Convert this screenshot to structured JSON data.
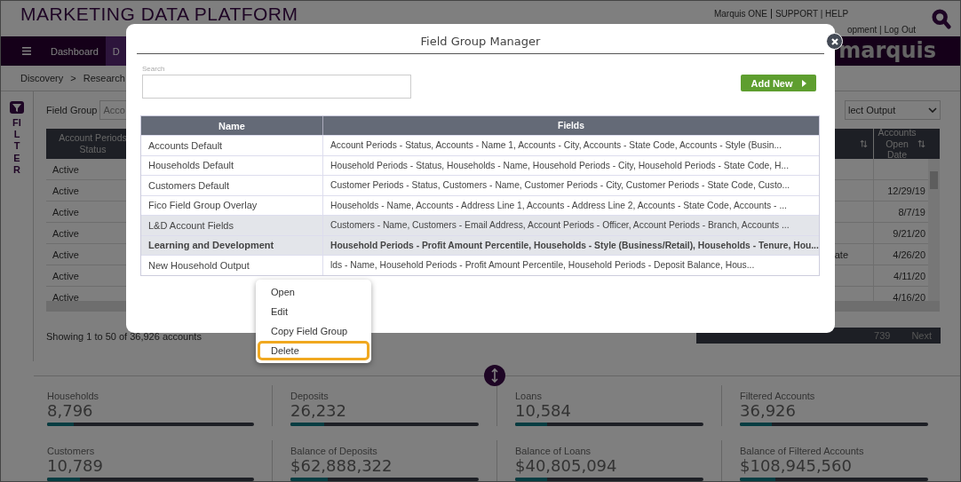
{
  "header": {
    "title": "MARKETING DATA PLATFORM",
    "top_links": [
      "Marquis ONE",
      "SUPPORT | HELP"
    ],
    "user_links": "opment | Log Out"
  },
  "nav": {
    "items": [
      {
        "label": "Dashboard",
        "selected": false
      },
      {
        "label": "D",
        "selected": true
      }
    ],
    "logo": "marquis"
  },
  "breadcrumb": {
    "items": [
      "Discovery",
      "Research"
    ],
    "separator": ">"
  },
  "sidebar": {
    "filter_label": "FILTER"
  },
  "filters": {
    "field_group_label": "Field Group",
    "field_group_value": "Acco",
    "output_value": "lect Output"
  },
  "accounts_table": {
    "columns": [
      "Account Periods Status",
      "Accounts Open Date"
    ],
    "rows": [
      {
        "status": "Active",
        "column_3": "",
        "open_date": ""
      },
      {
        "status": "Active",
        "column_3": "",
        "open_date": "12/29/19"
      },
      {
        "status": "Active",
        "column_3": "",
        "open_date": "8/7/19"
      },
      {
        "status": "Active",
        "column_3": "",
        "open_date": "9/21/20"
      },
      {
        "status": "Active",
        "column_3": "ate",
        "open_date": "4/26/20"
      },
      {
        "status": "Active",
        "column_3": "",
        "open_date": "4/11/20"
      },
      {
        "status": "Active",
        "column_3": "",
        "open_date": "4/16/20"
      }
    ]
  },
  "summary": "Showing 1 to 50 of 36,926 accounts",
  "pagination": {
    "last_page": "739",
    "next": "Next"
  },
  "stats": [
    {
      "label": "Households",
      "value": "8,796",
      "level": 0.13
    },
    {
      "label": "Deposits",
      "value": "26,232",
      "level": 0.18
    },
    {
      "label": "Loans",
      "value": "10,584",
      "level": 0.17
    },
    {
      "label": "Filtered Accounts",
      "value": "36,926",
      "level": 0.17
    },
    {
      "label": "Customers",
      "value": "10,789",
      "level": 0.16
    },
    {
      "label": "Balance of Deposits",
      "value": "$62,888,322",
      "level": 0.2
    },
    {
      "label": "Balance of Loans",
      "value": "$40,805,094",
      "level": 0.17
    },
    {
      "label": "Balance of Filtered Accounts",
      "value": "$108,945,560",
      "level": 0.19
    }
  ],
  "modal": {
    "title": "Field Group Manager",
    "search_label": "Search",
    "add_button": "Add New",
    "columns": [
      "Name",
      "Fields"
    ],
    "rows": [
      {
        "name": "Accounts Default",
        "fields": "Account Periods - Status, Accounts - Name 1, Accounts - City, Accounts - State Code, Accounts - Style (Busin...",
        "highlighted": false,
        "selected": false
      },
      {
        "name": "Households Default",
        "fields": "Household Periods - Status, Households - Name, Household Periods - City, Household Periods - State Code, H...",
        "highlighted": false,
        "selected": false
      },
      {
        "name": "Customers Default",
        "fields": "Customer Periods - Status, Customers - Name, Customer Periods - City, Customer Periods - State Code, Custo...",
        "highlighted": false,
        "selected": false
      },
      {
        "name": "Fico Field Group Overlay",
        "fields": "Households - Name, Accounts - Address Line 1, Accounts - Address Line 2, Accounts - State Code, Accounts - ...",
        "highlighted": false,
        "selected": false
      },
      {
        "name": "L&D Account Fields",
        "fields": "Customers - Name, Customers - Email Address, Account Periods - Officer, Account Periods - Branch, Accounts ...",
        "highlighted": true,
        "selected": false
      },
      {
        "name": "Learning and Development",
        "fields": "Household Periods - Profit Amount Percentile, Households - Style (Business/Retail), Households - Tenure, Hou...",
        "highlighted": true,
        "selected": true
      },
      {
        "name": "New Household Output",
        "fields": "lds - Name, Household Periods - Profit Amount Percentile, Household Periods - Deposit Balance, Hous...",
        "highlighted": false,
        "selected": false
      }
    ]
  },
  "context_menu": {
    "items": [
      {
        "label": "Open",
        "selected": false
      },
      {
        "label": "Edit",
        "selected": false
      },
      {
        "label": "Copy Field Group",
        "selected": false
      },
      {
        "label": "Delete",
        "selected": true
      }
    ]
  }
}
